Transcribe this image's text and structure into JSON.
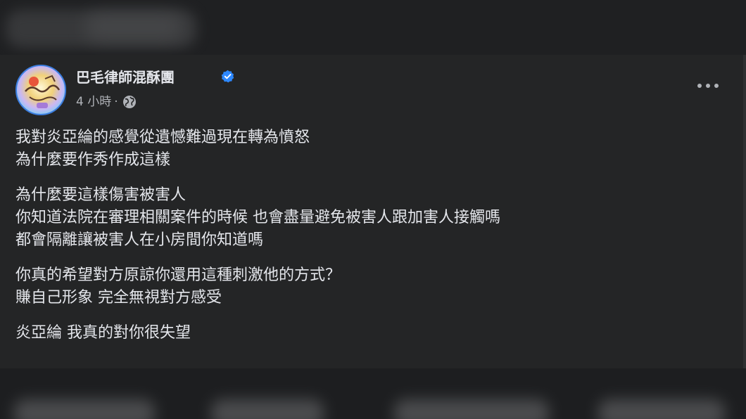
{
  "post": {
    "page_name": "巴毛律師混酥團",
    "time": "4 小時",
    "separator": "·",
    "privacy_icon": "globe-icon",
    "verified_icon": "verified-badge-icon",
    "more_icon": "more-options-icon",
    "paragraphs": [
      {
        "lines": [
          "我對炎亞綸的感覺從遺憾難過現在轉為憤怒",
          "為什麼要作秀作成這樣"
        ]
      },
      {
        "lines": [
          "為什麼要這樣傷害被害人",
          "你知道法院在審理相關案件的時候 也會盡量避免被害人跟加害人接觸嗎",
          "都會隔離讓被害人在小房間你知道嗎"
        ]
      },
      {
        "lines": [
          "你真的希望對方原諒你還用這種刺激他的方式？",
          "賺自己形象 完全無視對方感受"
        ]
      },
      {
        "lines": [
          "炎亞綸 我真的對你很失望"
        ]
      }
    ]
  },
  "colors": {
    "background": "#18191a",
    "card": "#242526",
    "primary_text": "#e4e6eb",
    "secondary_text": "#b0b3b8",
    "verified_blue": "#2d88ff"
  }
}
